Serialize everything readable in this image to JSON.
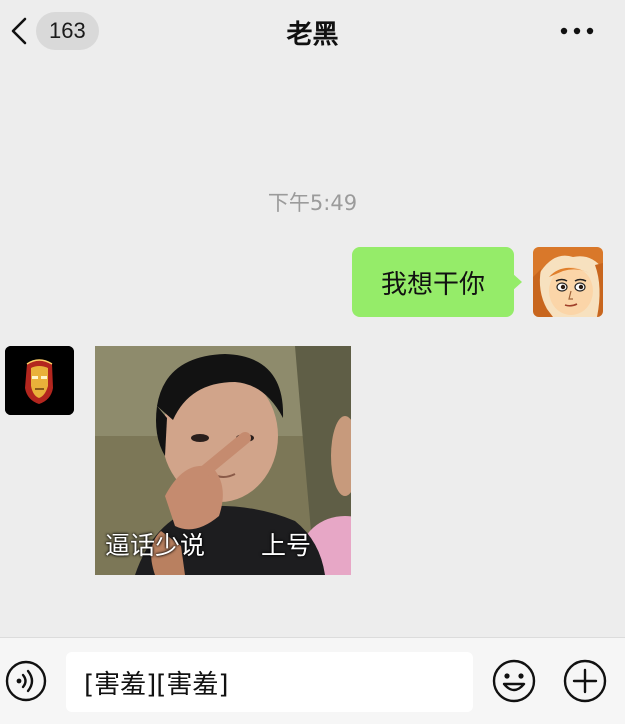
{
  "header": {
    "unread_count": "163",
    "title": "老黑",
    "icons": {
      "back": "chevron-left-icon",
      "more": "more-dots-icon"
    }
  },
  "chat": {
    "timestamp": "下午5:49",
    "messages": [
      {
        "side": "right",
        "type": "text",
        "text": "我想干你",
        "bubble_color": "#95ec69",
        "avatar": "cartoon-face-avatar"
      },
      {
        "side": "left",
        "type": "sticker",
        "captions": [
          "逼话少说",
          "上号"
        ],
        "avatar": "iron-mask-avatar"
      }
    ]
  },
  "input_bar": {
    "text": "[害羞][害羞]",
    "icons": {
      "voice": "voice-icon",
      "emoji": "emoji-icon",
      "more": "plus-icon"
    }
  },
  "colors": {
    "background": "#ededed",
    "bubble_self": "#95ec69",
    "timestamp": "#9b9b9b"
  }
}
